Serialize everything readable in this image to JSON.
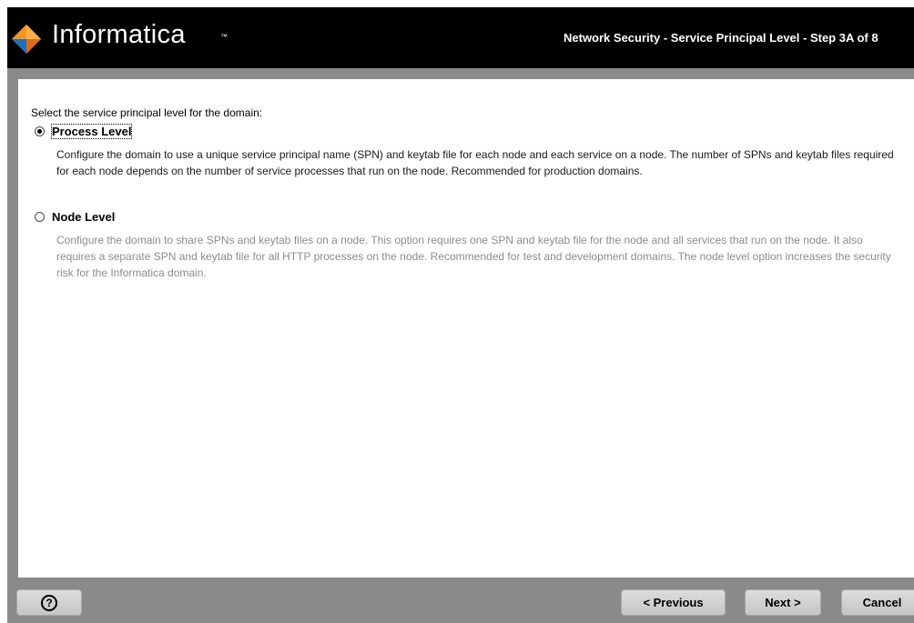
{
  "header": {
    "brand_name": "Informatica",
    "brand_tm": "™",
    "step_title": "Network Security - Service Principal Level - Step 3A of 8"
  },
  "main": {
    "prompt": "Select the service principal level for the domain:",
    "options": [
      {
        "label": "Process Level",
        "selected": true,
        "description": "Configure the domain to use a unique service principal name (SPN) and keytab file for each node and each service on a node. The number of SPNs and keytab files required for each node depends on the number of service processes that run on the node. Recommended for production domains."
      },
      {
        "label": "Node Level",
        "selected": false,
        "description": "Configure the domain to share SPNs and keytab files on a node. This option requires one SPN and keytab file for the node and all services that run on the node. It also requires a separate SPN and keytab file for all HTTP processes on the node. Recommended for test and development domains. The node level option increases the security risk for the Informatica domain."
      }
    ]
  },
  "footer": {
    "help_icon": "help-icon",
    "help_glyph": "?",
    "previous_label": "< Previous",
    "next_label": "Next >",
    "cancel_label": "Cancel"
  },
  "colors": {
    "header_bg": "#000000",
    "frame_gray": "#8a8a8a",
    "brand_orange": "#f7941d",
    "inactive_text": "#8c8c8c"
  }
}
